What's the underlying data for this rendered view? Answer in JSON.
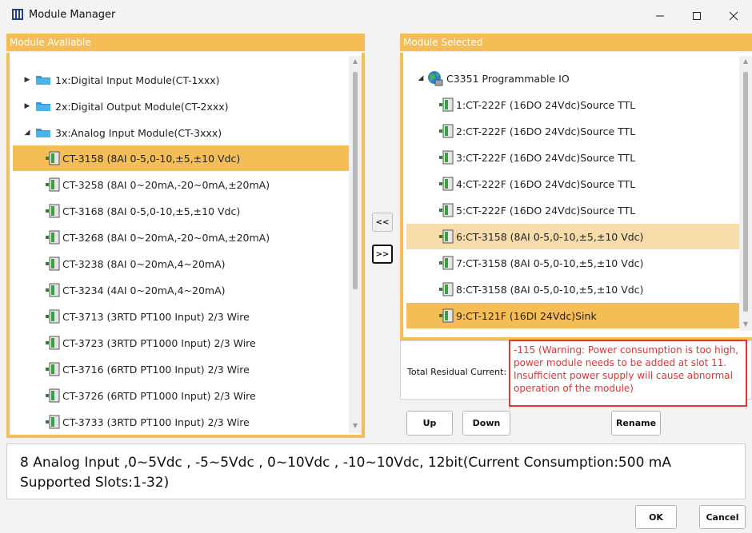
{
  "window": {
    "title": "Module Manager"
  },
  "left": {
    "header": "Module Avaliable",
    "items": [
      {
        "label": "1x:Digital Input Module(CT-1xxx)"
      },
      {
        "label": "2x:Digital Output Module(CT-2xxx)"
      },
      {
        "label": "3x:Analog Input Module(CT-3xxx)"
      },
      {
        "label": "CT-3158 (8AI 0-5,0-10,±5,±10 Vdc)"
      },
      {
        "label": "CT-3258 (8AI 0~20mA,-20~0mA,±20mA)"
      },
      {
        "label": "CT-3168 (8AI 0-5,0-10,±5,±10 Vdc)"
      },
      {
        "label": "CT-3268 (8AI 0~20mA,-20~0mA,±20mA)"
      },
      {
        "label": "CT-3238 (8AI 0~20mA,4~20mA)"
      },
      {
        "label": "CT-3234 (4AI 0~20mA,4~20mA)"
      },
      {
        "label": "CT-3713 (3RTD PT100 Input) 2/3 Wire"
      },
      {
        "label": "CT-3723 (3RTD PT1000 Input) 2/3 Wire"
      },
      {
        "label": "CT-3716 (6RTD PT100 Input) 2/3 Wire"
      },
      {
        "label": "CT-3726 (6RTD PT1000 Input) 2/3 Wire"
      },
      {
        "label": "CT-3733 (3RTD PT100 Input) 2/3 Wire"
      }
    ]
  },
  "middle": {
    "remove_label": "<<",
    "add_label": ">>"
  },
  "right": {
    "header": "Module Selected",
    "root_label": "C3351 Programmable IO",
    "items": [
      {
        "label": "1:CT-222F (16DO 24Vdc)Source TTL"
      },
      {
        "label": "2:CT-222F (16DO 24Vdc)Source TTL"
      },
      {
        "label": "3:CT-222F (16DO 24Vdc)Source TTL"
      },
      {
        "label": "4:CT-222F (16DO 24Vdc)Source TTL"
      },
      {
        "label": "5:CT-222F (16DO 24Vdc)Source TTL"
      },
      {
        "label": "6:CT-3158 (8AI 0-5,0-10,±5,±10 Vdc)"
      },
      {
        "label": "7:CT-3158 (8AI 0-5,0-10,±5,±10 Vdc)"
      },
      {
        "label": "8:CT-3158 (8AI 0-5,0-10,±5,±10 Vdc)"
      },
      {
        "label": "9:CT-121F (16DI 24Vdc)Sink"
      }
    ],
    "residual_label": "Total Residual Current:",
    "warning": "-115 (Warning: Power consumption is too high, power module needs to be added at slot 11. Insufficient power supply will cause abnormal operation of the module)",
    "up_label": "Up",
    "down_label": "Down",
    "rename_label": "Rename"
  },
  "description": "8 Analog Input ,0~5Vdc , -5~5Vdc , 0~10Vdc , -10~10Vdc, 12bit(Current Consumption:500 mA Supported Slots:1-32)",
  "footer": {
    "ok_label": "OK",
    "cancel_label": "Cancel"
  },
  "colors": {
    "accent": "#f4bd55",
    "accent_light": "#f6dca9",
    "warning": "#e53131"
  },
  "icons": [
    "grid-app-icon",
    "minimize-icon",
    "maximize-icon",
    "close-icon",
    "folder-icon",
    "expand-arrow-icon",
    "collapse-arrow-icon",
    "module-icon",
    "globe-icon"
  ]
}
